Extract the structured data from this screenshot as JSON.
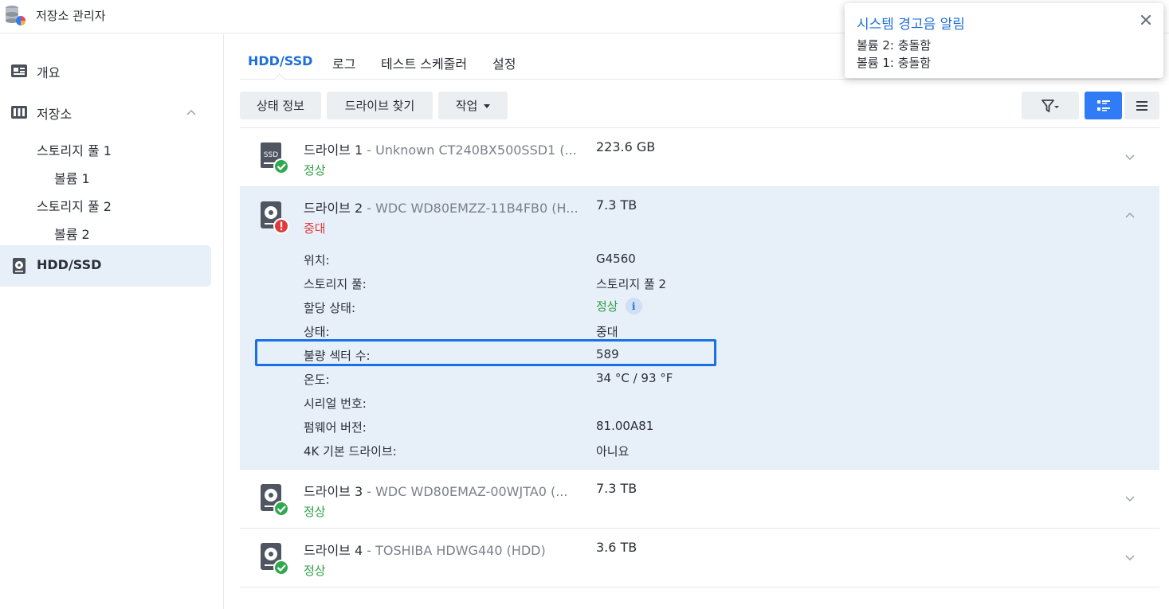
{
  "app": {
    "title": "저장소 관리자"
  },
  "sidebar": {
    "items": [
      {
        "label": "개요"
      },
      {
        "label": "저장소"
      },
      {
        "label": "스토리지 풀 1"
      },
      {
        "label": "볼륨 1"
      },
      {
        "label": "스토리지 풀 2"
      },
      {
        "label": "볼륨 2"
      },
      {
        "label": "HDD/SSD"
      }
    ]
  },
  "tabs": [
    {
      "label": "HDD/SSD"
    },
    {
      "label": "로그"
    },
    {
      "label": "테스트 스케줄러"
    },
    {
      "label": "설정"
    }
  ],
  "toolbar": {
    "status_info": "상태 정보",
    "find_drive": "드라이브 찾기",
    "action": "작업"
  },
  "drives": [
    {
      "name": "드라이브 1",
      "model": " - Unknown CT240BX500SSD1 (...",
      "size": "223.6 GB",
      "status": "정상",
      "type": "SSD"
    },
    {
      "name": "드라이브 2",
      "model": " - WDC WD80EMZZ-11B4FB0 (H...",
      "size": "7.3 TB",
      "status": "중대",
      "type": "HDD"
    },
    {
      "name": "드라이브 3",
      "model": " - WDC WD80EMAZ-00WJTA0 (...",
      "size": "7.3 TB",
      "status": "정상",
      "type": "HDD"
    },
    {
      "name": "드라이브 4",
      "model": " - TOSHIBA HDWG440 (HDD)",
      "size": "3.6 TB",
      "status": "정상",
      "type": "HDD"
    }
  ],
  "details": [
    {
      "label": "위치:",
      "value": "G4560"
    },
    {
      "label": "스토리지 풀:",
      "value": "스토리지 풀 2"
    },
    {
      "label": "할당 상태:",
      "value": "정상"
    },
    {
      "label": "상태:",
      "value": "중대"
    },
    {
      "label": "불량 섹터 수:",
      "value": "589"
    },
    {
      "label": "온도:",
      "value": "34 °C / 93 °F"
    },
    {
      "label": "시리얼 번호:",
      "value": ""
    },
    {
      "label": "펌웨어 버전:",
      "value": "81.00A81"
    },
    {
      "label": "4K 기본 드라이브:",
      "value": "아니요"
    }
  ],
  "notification": {
    "title": "시스템 경고음 알림",
    "lines": [
      "볼륨 2: 충돌함",
      "볼륨 1: 충돌함"
    ]
  },
  "colors": {
    "accent": "#1f6fd8",
    "ok": "#2f9e44",
    "critical": "#e03a3a",
    "highlight": "#1872e6"
  }
}
